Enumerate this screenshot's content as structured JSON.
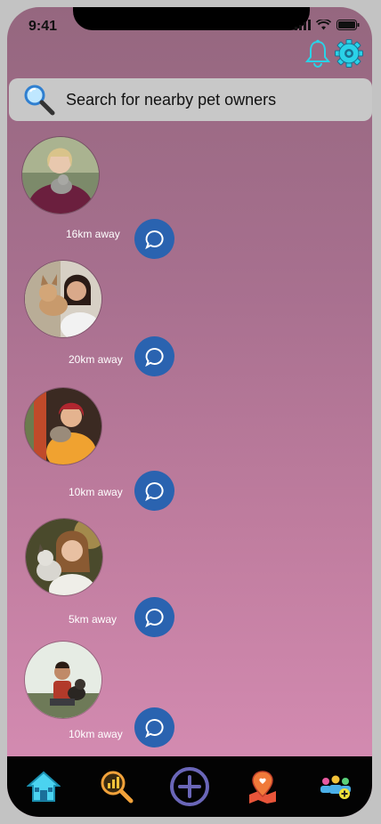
{
  "status_bar": {
    "time": "9:41"
  },
  "search": {
    "placeholder": "Search for nearby pet owners"
  },
  "owners": [
    {
      "distance": "16km away"
    },
    {
      "distance": "20km away"
    },
    {
      "distance": "10km away"
    },
    {
      "distance": "5km away"
    },
    {
      "distance": "10km away"
    }
  ],
  "icons": {
    "header": [
      "bell-icon",
      "gear-icon"
    ],
    "nav": [
      "home-icon",
      "stats-search-icon",
      "add-icon",
      "map-pin-icon",
      "group-add-icon"
    ]
  },
  "colors": {
    "accent": "#2a63b0",
    "gradient_top": "#95677f",
    "gradient_bottom": "#d88eb5",
    "nav_bg": "#030303"
  }
}
